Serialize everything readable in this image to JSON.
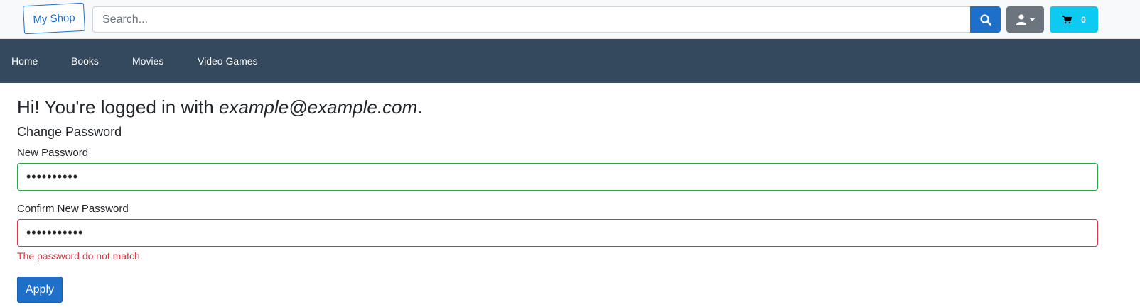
{
  "header": {
    "logo_text": "My Shop",
    "search": {
      "placeholder": "Search...",
      "value": ""
    },
    "search_icon": "search-icon",
    "user_icon": "user-icon",
    "cart_icon": "shopping-cart-icon",
    "cart_count": "0"
  },
  "nav": {
    "items": [
      {
        "label": "Home"
      },
      {
        "label": "Books"
      },
      {
        "label": "Movies"
      },
      {
        "label": "Video Games"
      }
    ]
  },
  "main": {
    "greeting_prefix": "Hi! You're logged in with ",
    "email": "example@example.com",
    "greeting_suffix": ".",
    "section_title": "Change Password",
    "new_password": {
      "label": "New Password",
      "value": "••••••••••"
    },
    "confirm_password": {
      "label": "Confirm New Password",
      "value": "•••••••••••"
    },
    "error_message": "The password do not match.",
    "apply_label": "Apply"
  },
  "colors": {
    "primary": "#1e6fc9",
    "navbar": "#34495e",
    "secondary": "#6c757d",
    "info": "#0dcaf0",
    "valid": "#28a745",
    "error": "#dc3545"
  }
}
